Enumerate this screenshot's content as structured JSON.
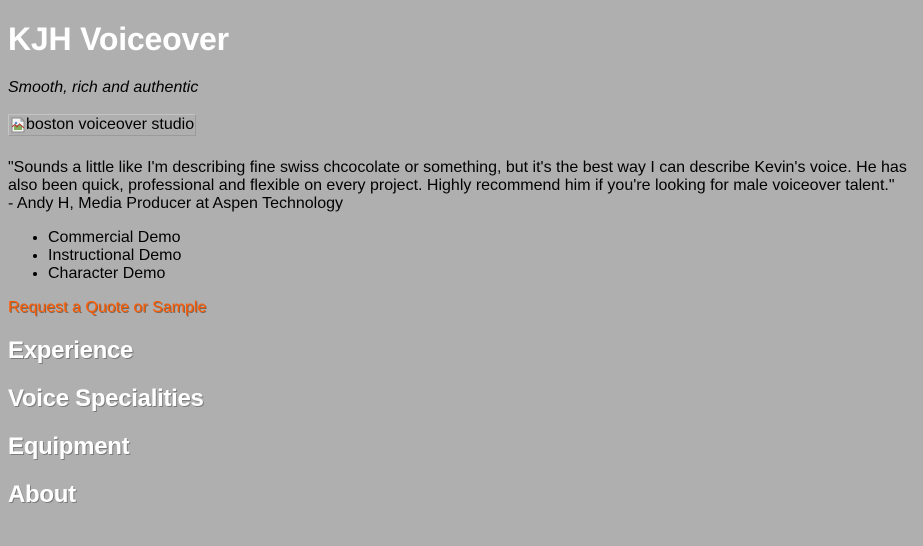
{
  "site": {
    "title": "KJH Voiceover",
    "tagline": "Smooth, rich and authentic"
  },
  "studio_image": {
    "alt": "boston voiceover studio",
    "icon": "broken-image-icon"
  },
  "testimonial": {
    "quote": "\"Sounds a little like I'm describing fine swiss chcocolate or something, but it's the best way I can describe Kevin's voice. He has also been quick, professional and flexible on every project. Highly recommend him if you're looking for male voiceover talent.\"",
    "attribution": "- Andy H, Media Producer at Aspen Technology"
  },
  "demos": [
    "Commercial Demo",
    "Instructional Demo",
    "Character Demo"
  ],
  "cta": {
    "label": "Request a Quote or Sample"
  },
  "sections": [
    "Experience",
    "Voice Specialities",
    "Equipment",
    "About"
  ],
  "colors": {
    "background": "#afafaf",
    "heading": "#ffffff",
    "link": "#ff5a00"
  }
}
